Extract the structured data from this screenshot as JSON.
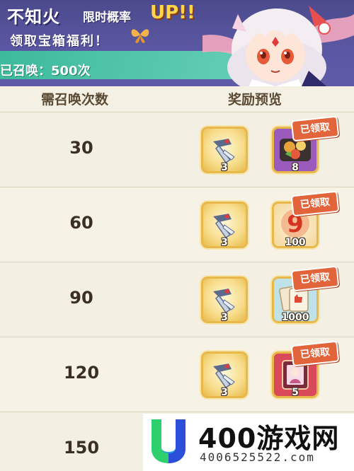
{
  "banner": {
    "title_main": "不知火",
    "title_sub": "限时概率",
    "title_up": "UP!!",
    "subtitle": "领取宝箱福利！",
    "summon_count": "已召唤：500次"
  },
  "table": {
    "col_count": "需召唤次数",
    "col_reward": "奖励预览",
    "rows": [
      {
        "count": "30",
        "item1_qty": "3",
        "item2_qty": "8",
        "claimed": "已领取",
        "item2_icon": "food-bento-icon"
      },
      {
        "count": "60",
        "item1_qty": "3",
        "item2_qty": "100",
        "claimed": "已领取",
        "item2_icon": "number-nine-icon"
      },
      {
        "count": "90",
        "item1_qty": "3",
        "item2_qty": "1000",
        "claimed": "已领取",
        "item2_icon": "like-cards-icon"
      },
      {
        "count": "120",
        "item1_qty": "3",
        "item2_qty": "5",
        "claimed": "已领取",
        "item2_icon": "portrait-frame-icon"
      },
      {
        "count": "150"
      }
    ]
  },
  "watermark": {
    "name": "400游戏网",
    "phone": "4006525522.com"
  },
  "colors": {
    "banner": "#5a57a2",
    "accent_green": "#3bb99b",
    "claimed_badge": "#e2643b",
    "gold_frame": "#e9b84a",
    "background": "#f4f0e3"
  }
}
